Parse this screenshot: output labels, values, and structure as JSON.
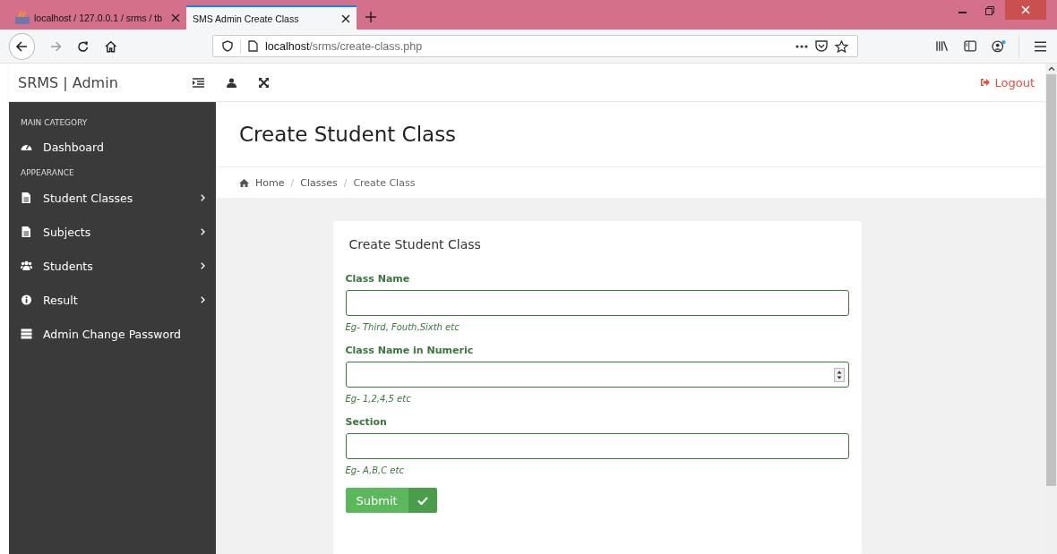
{
  "browser": {
    "tabs": [
      {
        "title": "localhost / 127.0.0.1 / srms / tb",
        "selected": false
      },
      {
        "title": "SMS Admin Create Class",
        "selected": true
      }
    ],
    "url_host": "localhost",
    "url_path": "/srms/create-class.php"
  },
  "topbar": {
    "brand": "SRMS | Admin",
    "logout": "Logout"
  },
  "sidebar": {
    "sections": [
      {
        "heading": "MAIN CATEGORY",
        "items": [
          {
            "label": "Dashboard",
            "kind": "gauge",
            "has_submenu": false
          }
        ]
      },
      {
        "heading": "APPEARANCE",
        "items": [
          {
            "label": "Student Classes",
            "kind": "file",
            "has_submenu": true
          },
          {
            "label": "Subjects",
            "kind": "file",
            "has_submenu": true
          },
          {
            "label": "Students",
            "kind": "users",
            "has_submenu": true
          },
          {
            "label": "Result",
            "kind": "info",
            "has_submenu": true
          },
          {
            "label": "Admin Change Password",
            "kind": "server",
            "has_submenu": false
          }
        ]
      }
    ]
  },
  "page": {
    "title": "Create Student Class",
    "breadcrumb": [
      "Home",
      "Classes",
      "Create Class"
    ],
    "breadcrumb_separator": "/"
  },
  "form": {
    "title": "Create Student Class",
    "fields": [
      {
        "label": "Class Name",
        "kind": "text",
        "help": "Eg- Third, Fouth,Sixth etc"
      },
      {
        "label": "Class Name in Numeric",
        "kind": "number",
        "help": "Eg- 1,2,4,5 etc"
      },
      {
        "label": "Section",
        "kind": "text",
        "help": "Eg- A,B,C etc"
      }
    ],
    "submit": "Submit"
  }
}
